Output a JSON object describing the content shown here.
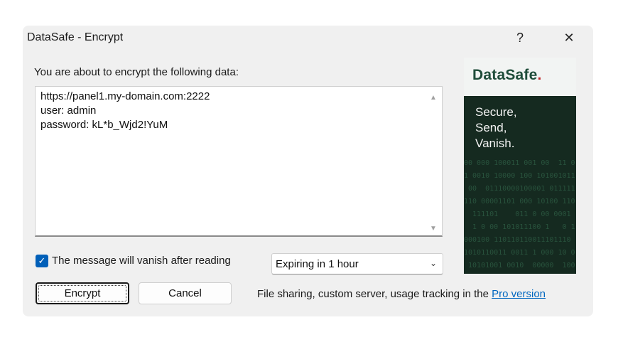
{
  "window": {
    "title": "DataSafe - Encrypt",
    "help_glyph": "?",
    "close_glyph": "✕"
  },
  "main": {
    "prompt": "You are about to encrypt the following data:",
    "content_lines": [
      "https://panel1.my-domain.com:2222",
      "user: admin",
      "password: kL*b_Wjd2!YuM"
    ],
    "vanish_label": "The message will vanish after reading",
    "vanish_checked": true,
    "expiry_selected": "Expiring in 1 hour"
  },
  "buttons": {
    "encrypt": "Encrypt",
    "cancel": "Cancel"
  },
  "footer": {
    "text": "File sharing, custom server, usage tracking in the ",
    "link": "Pro version"
  },
  "banner": {
    "brand": "DataSafe",
    "brand_dot": ".",
    "tagline": [
      "Secure,",
      "Send,",
      "Vanish."
    ]
  },
  "colors": {
    "accent": "#005fb8",
    "link": "#0067c0",
    "brand_green": "#1f4d3a",
    "brand_red": "#c0282c",
    "banner_dark": "#152a20"
  },
  "icons": {
    "help": "question-mark-icon",
    "close": "close-icon",
    "checkbox": "checkmark-icon",
    "dropdown": "chevron-down-icon",
    "scroll_up": "scroll-up-arrow-icon",
    "scroll_down": "scroll-down-arrow-icon"
  }
}
